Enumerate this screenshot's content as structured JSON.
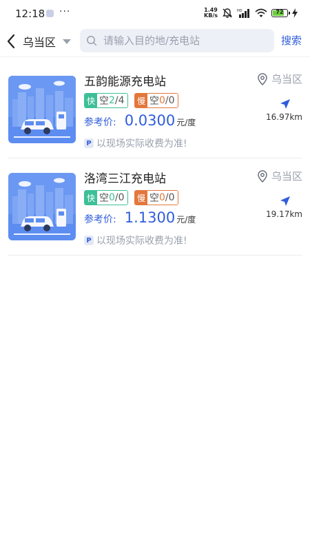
{
  "status_bar": {
    "time": "12:18",
    "more": "···",
    "net_speed_value": "1.49",
    "net_speed_unit": "KB/s",
    "battery": "72"
  },
  "header": {
    "region": "乌当区",
    "search_placeholder": "请输入目的地/充电站",
    "search_button": "搜索"
  },
  "stations": [
    {
      "name": "五韵能源充电站",
      "area": "乌当区",
      "fast_label": "快",
      "fast_prefix": "空",
      "fast_free": "2",
      "fast_total": "4",
      "slow_label": "慢",
      "slow_prefix": "空",
      "slow_free": "0",
      "slow_total": "0",
      "price_label": "参考价:",
      "price": "0.0300",
      "price_unit": "元/度",
      "distance": "16.97km",
      "note_icon": "P",
      "note": "以现场实际收费为准!"
    },
    {
      "name": "洛湾三江充电站",
      "area": "乌当区",
      "fast_label": "快",
      "fast_prefix": "空",
      "fast_free": "0",
      "fast_total": "0",
      "slow_label": "慢",
      "slow_prefix": "空",
      "slow_free": "0",
      "slow_total": "0",
      "price_label": "参考价:",
      "price": "1.1300",
      "price_unit": "元/度",
      "distance": "19.17km",
      "note_icon": "P",
      "note": "以现场实际收费为准!"
    }
  ],
  "colors": {
    "accent": "#2f5ddb",
    "fast": "#3dbf97",
    "slow": "#e3773c",
    "muted": "#9aa0ad"
  }
}
